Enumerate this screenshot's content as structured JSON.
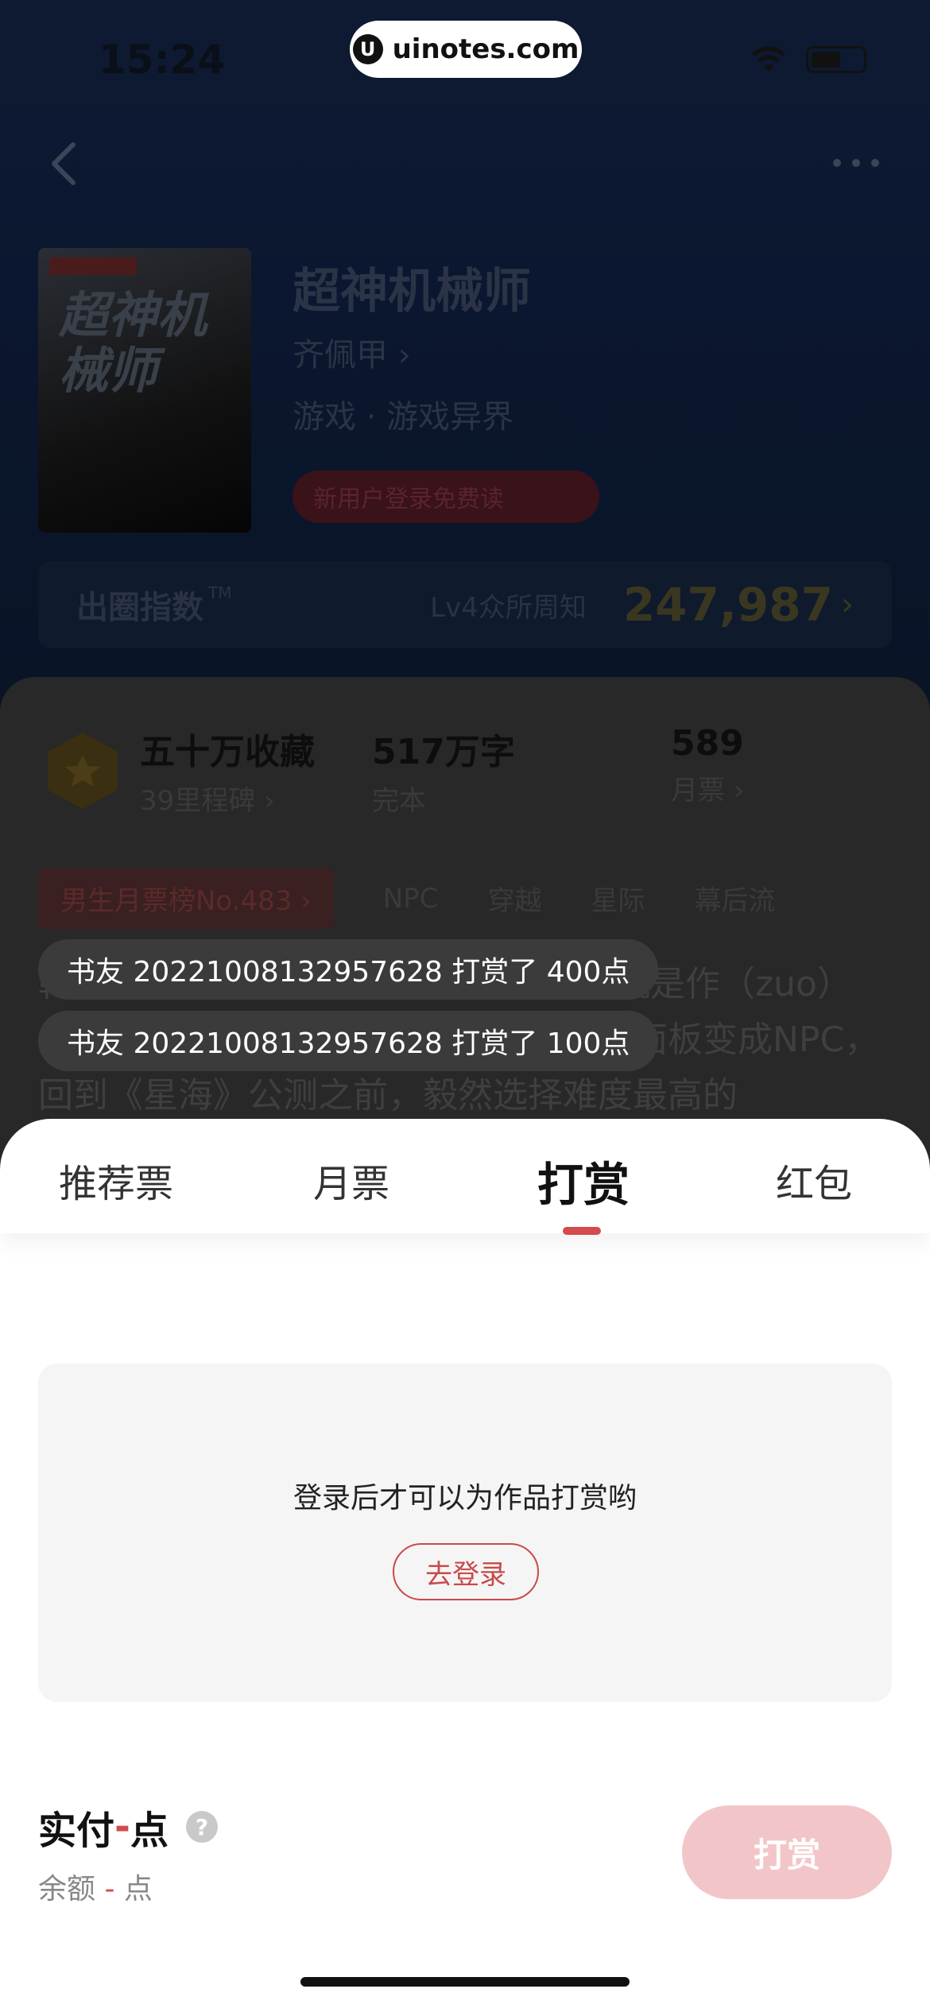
{
  "status_bar": {
    "time": "15:24",
    "watermark": "uinotes.com"
  },
  "book": {
    "cover_title": "超神机械师",
    "title": "超神机械师",
    "author": "齐佩甲 ›",
    "genre": "游戏 · 游戏异界",
    "promo": "新用户登录免费读"
  },
  "index": {
    "label": "出圈指数",
    "tm": "TM",
    "level": "Lv4众所周知",
    "score": "247,987",
    "chevron": "›"
  },
  "stats": [
    {
      "value": "五十万收藏",
      "label": "39里程碑 ›"
    },
    {
      "value": "517万字",
      "label": "完本"
    },
    {
      "value": "589",
      "label": "月票 ›"
    }
  ],
  "tags": [
    "男生月票榜No.483 ›",
    "NPC",
    "穿越",
    "星际",
    "幕后流"
  ],
  "description": "韩萧，《星海》骨灰级大神，最喜欢的就是作（zuo）方，一觉醒来，穿越到星海世界，玩家面板变成NPC，回到《星海》公测之前，毅然选择难度最高的",
  "toasts": [
    "书友 20221008132957628 打赏了 400点",
    "书友 20221008132957628 打赏了 100点"
  ],
  "sheet": {
    "tabs": [
      "推荐票",
      "月票",
      "打赏",
      "红包"
    ],
    "active_tab": "打赏",
    "login_prompt": "登录后才可以为作品打赏哟",
    "login_button": "去登录",
    "pay_prefix": "实付",
    "pay_value": "-",
    "pay_unit": "点",
    "help": "?",
    "balance_prefix": "余额",
    "balance_value": "-",
    "balance_unit": "点",
    "reward_button": "打赏"
  },
  "colors": {
    "accent": "#d34b4b",
    "reward_button_disabled": "#f2c6c8"
  }
}
